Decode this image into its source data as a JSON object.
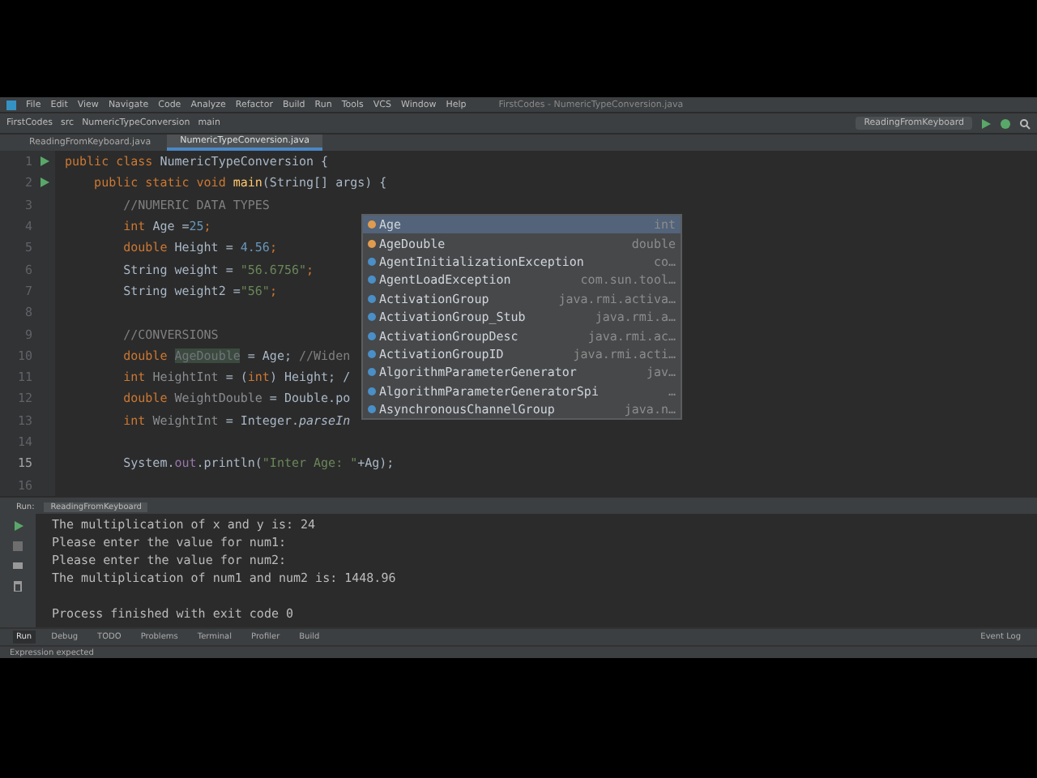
{
  "menu_bar": {
    "items": [
      "File",
      "Edit",
      "View",
      "Navigate",
      "Code",
      "Analyze",
      "Refactor",
      "Build",
      "Run",
      "Tools",
      "VCS",
      "Window",
      "Help"
    ],
    "title": "FirstCodes - NumericTypeConversion.java"
  },
  "nav_bar": {
    "breadcrumbs": [
      "FirstCodes",
      "src",
      "NumericTypeConversion",
      "main"
    ],
    "run_config": "ReadingFromKeyboard"
  },
  "editor_tabs": [
    {
      "label": "ReadingFromKeyboard.java",
      "selected": false
    },
    {
      "label": "NumericTypeConversion.java",
      "selected": true
    }
  ],
  "editor": {
    "lines": [
      {
        "number": "1",
        "runnable": true,
        "tokens": [
          {
            "kind": "kw",
            "text": "public class "
          },
          {
            "kind": "id",
            "text": "NumericTypeConversion {"
          }
        ]
      },
      {
        "number": "2",
        "runnable": true,
        "tokens": [
          {
            "kind": "kw",
            "text": "    public static void "
          },
          {
            "kind": "method",
            "text": "main"
          },
          {
            "kind": "id",
            "text": "(String[] args) {"
          }
        ]
      },
      {
        "number": "3",
        "runnable": false,
        "tokens": [
          {
            "kind": "comment",
            "text": "        //NUMERIC DATA TYPES"
          }
        ]
      },
      {
        "number": "4",
        "runnable": false,
        "tokens": [
          {
            "kind": "kw",
            "text": "        int "
          },
          {
            "kind": "id",
            "text": "Age ="
          },
          {
            "kind": "num",
            "text": "25"
          },
          {
            "kind": "kw",
            "text": ";"
          }
        ]
      },
      {
        "number": "5",
        "runnable": false,
        "tokens": [
          {
            "kind": "kw",
            "text": "        double "
          },
          {
            "kind": "id",
            "text": "Height = "
          },
          {
            "kind": "num",
            "text": "4.56"
          },
          {
            "kind": "kw",
            "text": ";"
          }
        ]
      },
      {
        "number": "6",
        "runnable": false,
        "tokens": [
          {
            "kind": "id",
            "text": "        String weight = "
          },
          {
            "kind": "str",
            "text": "\"56.6756\""
          },
          {
            "kind": "kw",
            "text": ";"
          }
        ]
      },
      {
        "number": "7",
        "runnable": false,
        "tokens": [
          {
            "kind": "id",
            "text": "        String weight2 ="
          },
          {
            "kind": "str",
            "text": "\"56\""
          },
          {
            "kind": "kw",
            "text": ";"
          }
        ]
      },
      {
        "number": "8",
        "runnable": false
      },
      {
        "number": "9",
        "runnable": false,
        "tokens": [
          {
            "kind": "comment",
            "text": "        //CONVERSIONS"
          }
        ]
      },
      {
        "number": "10",
        "runnable": false,
        "tokens": [
          {
            "kind": "kw",
            "text": "        double "
          },
          {
            "kind": "unused",
            "text": "AgeDouble"
          },
          {
            "kind": "id",
            "text": " = Age; "
          },
          {
            "kind": "comment",
            "text": "//Widen"
          }
        ]
      },
      {
        "number": "11",
        "runnable": false,
        "tokens": [
          {
            "kind": "kw",
            "text": "        int "
          },
          {
            "kind": "unusedvar",
            "text": "HeightInt"
          },
          {
            "kind": "id",
            "text": " = ("
          },
          {
            "kind": "kw",
            "text": "int"
          },
          {
            "kind": "id",
            "text": ") Height; /"
          }
        ]
      },
      {
        "number": "12",
        "runnable": false,
        "tokens": [
          {
            "kind": "kw",
            "text": "        double "
          },
          {
            "kind": "unusedvar",
            "text": "WeightDouble"
          },
          {
            "kind": "id",
            "text": " = Double.po"
          }
        ]
      },
      {
        "number": "13",
        "runnable": false,
        "tokens": [
          {
            "kind": "kw",
            "text": "        int "
          },
          {
            "kind": "unusedvar",
            "text": "WeightInt"
          },
          {
            "kind": "id",
            "text": " = Integer."
          },
          {
            "kind": "italic",
            "text": "parseIn"
          }
        ]
      },
      {
        "number": "14",
        "runnable": false
      },
      {
        "number": "15",
        "runnable": false,
        "tokens": [
          {
            "kind": "id",
            "text": "        System."
          },
          {
            "kind": "field",
            "text": "out"
          },
          {
            "kind": "id",
            "text": ".println("
          },
          {
            "kind": "str",
            "text": "\"Inter Age: \""
          },
          {
            "kind": "id",
            "text": "+Ag);"
          }
        ]
      },
      {
        "number": "16",
        "runnable": false
      }
    ]
  },
  "completion_popup": [
    {
      "name": "Age",
      "type": "int",
      "kind": "variable",
      "selected": true
    },
    {
      "name": "AgeDouble",
      "type": "double",
      "kind": "variable",
      "selected": false
    },
    {
      "name": "AgentInitializationException",
      "type": "co…",
      "kind": "class",
      "selected": false
    },
    {
      "name": "AgentLoadException",
      "type": "com.sun.tool…",
      "kind": "class",
      "selected": false
    },
    {
      "name": "ActivationGroup",
      "type": "java.rmi.activa…",
      "kind": "class",
      "selected": false
    },
    {
      "name": "ActivationGroup_Stub",
      "type": "java.rmi.a…",
      "kind": "class",
      "selected": false
    },
    {
      "name": "ActivationGroupDesc",
      "type": "java.rmi.ac…",
      "kind": "class",
      "selected": false
    },
    {
      "name": "ActivationGroupID",
      "type": "java.rmi.acti…",
      "kind": "class",
      "selected": false
    },
    {
      "name": "AlgorithmParameterGenerator",
      "type": "jav…",
      "kind": "class",
      "selected": false
    },
    {
      "name": "AlgorithmParameterGeneratorSpi",
      "type": "…",
      "kind": "class",
      "selected": false
    },
    {
      "name": "AsynchronousChannelGroup",
      "type": "java.n…",
      "kind": "class",
      "selected": false
    }
  ],
  "run_panel": {
    "label": "Run:",
    "tab": "ReadingFromKeyboard",
    "output": [
      {
        "kind": "stdout",
        "text": "The multiplication of x and y is: 24"
      },
      {
        "kind": "stdout",
        "text": "Please enter the value for num1:"
      },
      {
        "kind": "stdout",
        "text": "Please enter the value for num2:"
      },
      {
        "kind": "stdout",
        "text": "The multiplication of num1 and num2 is: 1448.96"
      },
      {
        "kind": "exit",
        "text": "Process finished with exit code 0"
      }
    ]
  },
  "tool_window_bar": [
    {
      "label": "Run",
      "selected": true
    },
    {
      "label": "Debug",
      "selected": false
    },
    {
      "label": "TODO",
      "selected": false
    },
    {
      "label": "Problems",
      "selected": false
    },
    {
      "label": "Terminal",
      "selected": false
    },
    {
      "label": "Profiler",
      "selected": false
    },
    {
      "label": "Build",
      "selected": false
    }
  ],
  "event_log": "Event Log",
  "status_bar": {
    "message": "Expression expected"
  }
}
